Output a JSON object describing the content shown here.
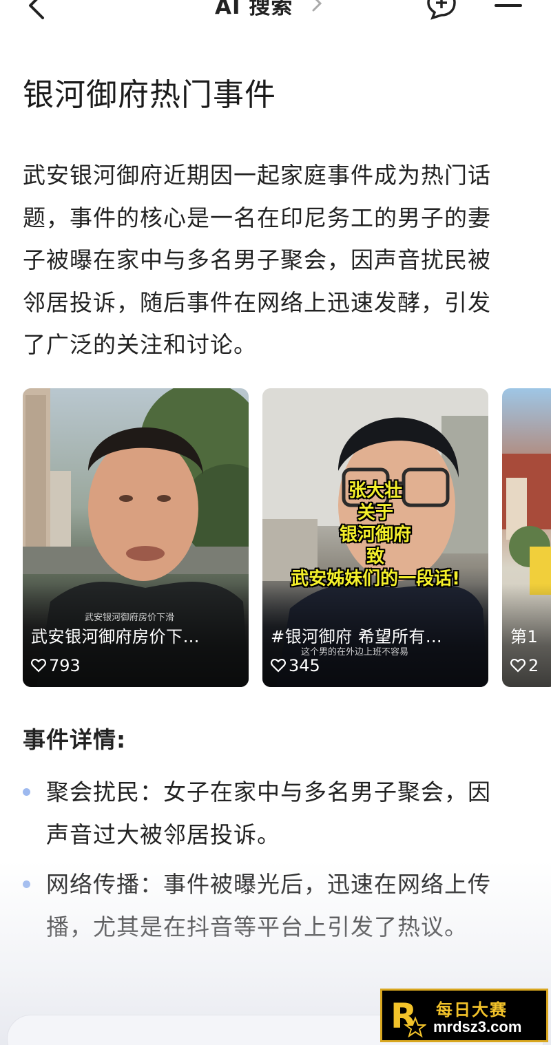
{
  "header": {
    "title": "AI 搜索"
  },
  "page": {
    "title": "银河御府热门事件",
    "intro": "武安银河御府近期因一起家庭事件成为热门话题，事件的核心是一名在印尼务工的男子的妻子被曝在家中与多名男子聚会，因声音扰民被邻居投诉，随后事件在网络上迅速发酵，引发了广泛的关注和讨论。"
  },
  "videos": [
    {
      "overlay_text": "武安银河御府房价下滑",
      "title": "武安银河御府房价下…",
      "likes": "793"
    },
    {
      "caption": [
        "张大壮",
        "关于",
        "银河御府",
        "致",
        "武安姊妹们的一段话!"
      ],
      "title": "#银河御府 希望所有…",
      "overlay_text": "这个男的在外边上班不容易",
      "likes": "345"
    },
    {
      "title": "第1",
      "likes": "2"
    }
  ],
  "details": {
    "heading": "事件详情:",
    "items": [
      "聚会扰民：女子在家中与多名男子聚会，因声音过大被邻居投诉。",
      "网络传播：事件被曝光后，迅速在网络上传播，尤其是在抖音等平台上引发了热议。"
    ]
  },
  "watermark": {
    "site_name": "每日大赛",
    "url": "mrdsz3.com"
  },
  "colors": {
    "bullet_dot": "#9db9ef",
    "caption_yellow": "#f4f02a",
    "watermark_gold": "#d9a720"
  }
}
